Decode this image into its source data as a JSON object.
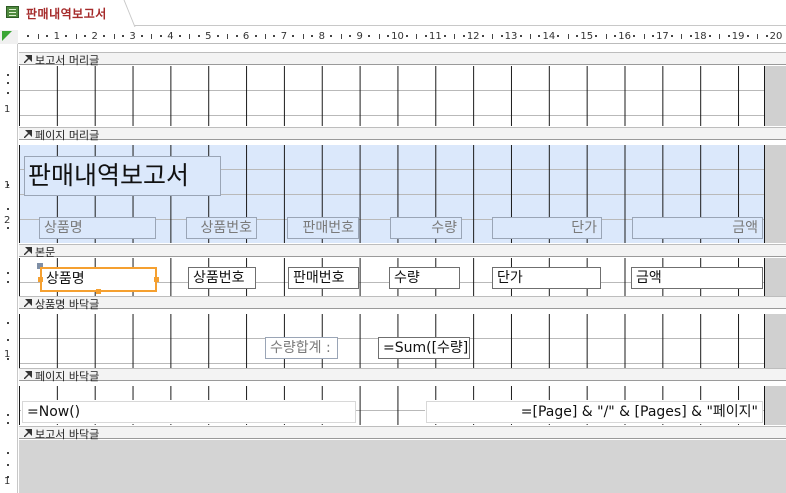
{
  "tab": {
    "title": "판매내역보고서"
  },
  "ruler": {
    "marks": [
      "1",
      "2",
      "3",
      "4",
      "5",
      "6",
      "7",
      "8",
      "9",
      "10",
      "11",
      "12",
      "13",
      "14",
      "15",
      "16",
      "17",
      "18",
      "19",
      "20"
    ]
  },
  "vruler": {
    "labels": [
      "1",
      "1",
      "2",
      "1",
      "1"
    ]
  },
  "sections": {
    "report_header": "보고서 머리글",
    "page_header": "페이지 머리글",
    "detail": "본문",
    "group_footer": "상품명 바닥글",
    "page_footer": "페이지 바닥글",
    "report_footer": "보고서 바닥글"
  },
  "page_header": {
    "title": "판매내역보고서",
    "labels": [
      "상품명",
      "상품번호",
      "판매번호",
      "수량",
      "단가",
      "금액"
    ]
  },
  "detail": {
    "fields": [
      "상품명",
      "상품번호",
      "판매번호",
      "수량",
      "단가",
      "금액"
    ]
  },
  "group_footer": {
    "total_label": "수량합계 :",
    "total_expr": "=Sum([수량])"
  },
  "page_footer": {
    "now_expr": "=Now()",
    "page_expr": "=[Page] & \"/\" & [Pages] & \"페이지\""
  },
  "colors": {
    "tab_title": "#a52a2a",
    "header_band": "#dbe8fb",
    "selection": "#f5a030"
  }
}
